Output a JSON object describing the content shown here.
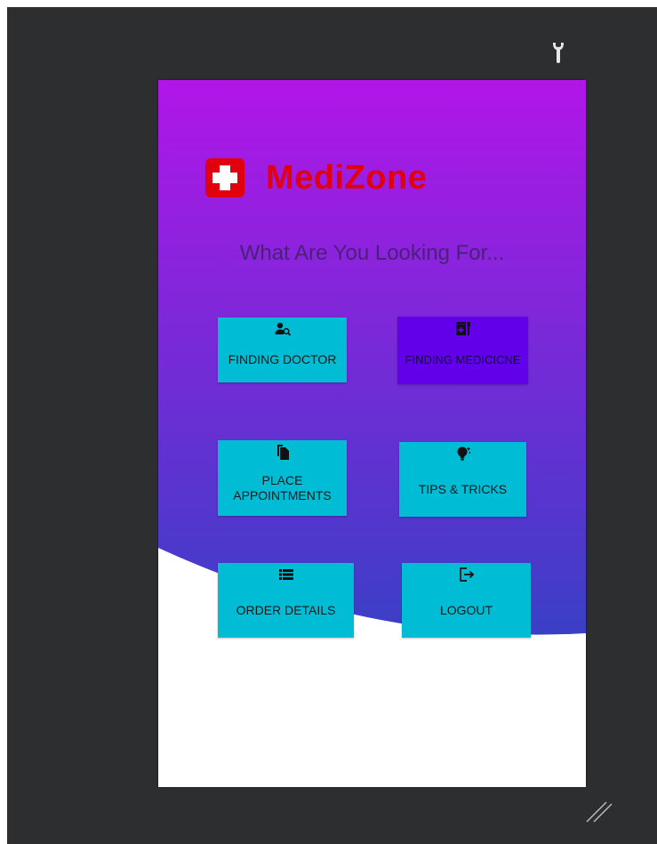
{
  "app": {
    "brand_name": "MediZone",
    "prompt": "What Are You Looking For..."
  },
  "tiles": [
    {
      "id": "finding-doctor",
      "label": "FINDING DOCTOR",
      "icon": "person-search-icon"
    },
    {
      "id": "finding-medicine",
      "label": "FINDING MEDICICNE",
      "icon": "medical-kit-icon"
    },
    {
      "id": "place-appointments",
      "label": "PLACE APPOINTMENTS",
      "icon": "documents-icon"
    },
    {
      "id": "tips-tricks",
      "label": "TIPS & TRICKS",
      "icon": "lightbulb-icon"
    },
    {
      "id": "order-details",
      "label": "ORDER DETAILS",
      "icon": "list-icon"
    },
    {
      "id": "logout",
      "label": "LOGOUT",
      "icon": "logout-icon"
    }
  ],
  "colors": {
    "gradient_top": "#b116e8",
    "gradient_bottom": "#3a3fc6",
    "tile_primary": "#00bcd4",
    "tile_selected": "#6200ea",
    "brand_red": "#e0000e",
    "workspace": "#2d2e30"
  },
  "chrome": {
    "tool_icon": "wrench-icon",
    "resize_icon": "resize-grip-icon"
  }
}
